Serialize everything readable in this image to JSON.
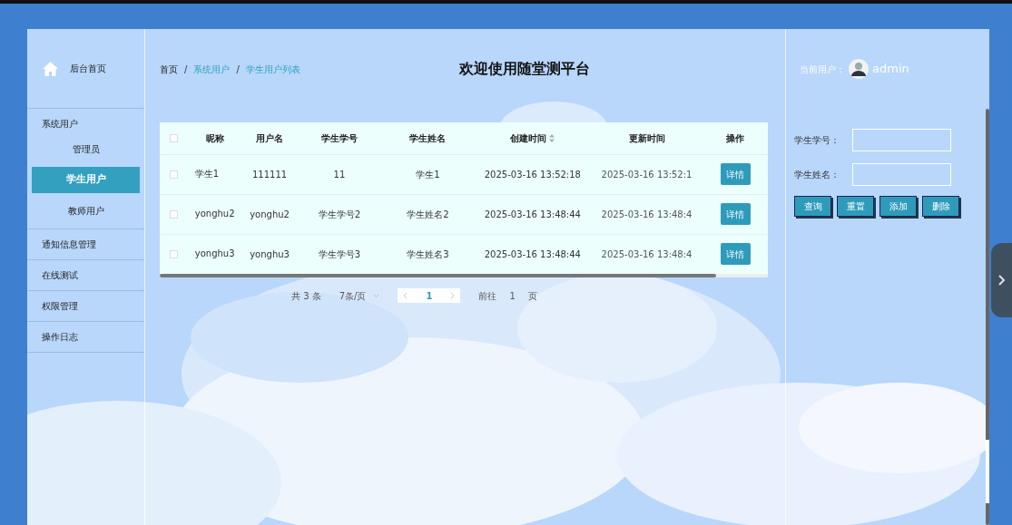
{
  "sidebar": {
    "home": {
      "label": "后台首页"
    },
    "items": [
      {
        "label": "系统用户",
        "children": [
          {
            "label": "管理员",
            "selected": false
          },
          {
            "label": "学生用户",
            "selected": true
          },
          {
            "label": "教师用户",
            "selected": false
          }
        ]
      },
      {
        "label": "通知信息管理"
      },
      {
        "label": "在线测试"
      },
      {
        "label": "权限管理"
      },
      {
        "label": "操作日志"
      }
    ]
  },
  "breadcrumb": [
    {
      "label": "首页",
      "current": false,
      "separator": "/"
    },
    {
      "label": "系统用户",
      "current": true,
      "separator": "/"
    },
    {
      "label": "学生用户列表",
      "current": true
    }
  ],
  "header": {
    "title": "欢迎使用随堂测平台",
    "user_label": "当前用户：",
    "user_name": "admin"
  },
  "table": {
    "all_checked": false,
    "columns": [
      {
        "label": "昵称",
        "sortable": false
      },
      {
        "label": "用户名",
        "sortable": false
      },
      {
        "label": "学生学号",
        "sortable": false
      },
      {
        "label": "学生姓名",
        "sortable": false
      },
      {
        "label": "创建时间",
        "sortable": true
      },
      {
        "label": "更新时间",
        "sortable": false
      },
      {
        "label": "操作",
        "sortable": false
      }
    ],
    "rows": [
      {
        "checked": false,
        "cells": [
          "学生1",
          "111111",
          "11",
          "学生1",
          "2025-03-16 13:52:18",
          "2025-03-16 13:52:1"
        ],
        "action": "详情"
      },
      {
        "checked": false,
        "cells": [
          "yonghu2",
          "yonghu2",
          "学生学号2",
          "学生姓名2",
          "2025-03-16 13:48:44",
          "2025-03-16 13:48:4"
        ],
        "action": "详情"
      },
      {
        "checked": false,
        "cells": [
          "yonghu3",
          "yonghu3",
          "学生学号3",
          "学生姓名3",
          "2025-03-16 13:48:44",
          "2025-03-16 13:48:4"
        ],
        "action": "详情"
      }
    ]
  },
  "pagination": {
    "total": "共 3 条",
    "page_size": "7条/页",
    "pages": [
      {
        "label": "1",
        "selected": true
      }
    ],
    "goto_label": "前往",
    "goto_value": "1",
    "goto_suffix": "页"
  },
  "search": {
    "fields": [
      {
        "label": "学生学号："
      },
      {
        "label": "学生姓名："
      }
    ],
    "buttons": [
      "查询",
      "重置",
      "添加",
      "删除"
    ]
  }
}
